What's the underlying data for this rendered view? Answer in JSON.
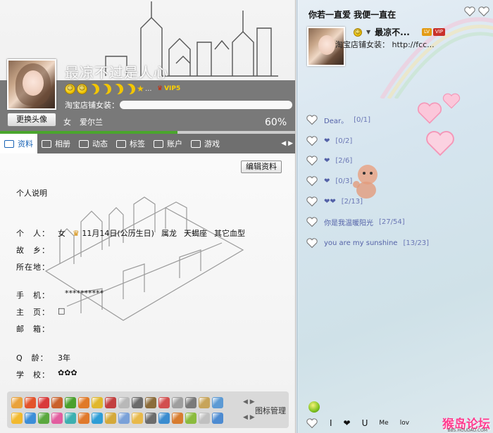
{
  "profile": {
    "nickname": "最凉不过是人心",
    "change_avatar_label": "更换头像",
    "shop_prefix": "淘宝店铺女装：",
    "gender": "女",
    "name": "爱尔兰",
    "completion_percent": "60%",
    "completion_fraction": 0.6,
    "vip_label": "VIP5",
    "level_icons": [
      "smiley-icon",
      "smiley-icon",
      "moon-icon",
      "moon-icon",
      "moon-icon",
      "moon-icon",
      "star-icon"
    ],
    "more_dots": "..."
  },
  "tabs": [
    {
      "label": "资料",
      "icon": "profile-card-icon",
      "active": true
    },
    {
      "label": "相册",
      "icon": "photo-album-icon",
      "active": false
    },
    {
      "label": "动态",
      "icon": "feed-list-icon",
      "active": false
    },
    {
      "label": "标签",
      "icon": "bookmark-icon",
      "active": false
    },
    {
      "label": "账户",
      "icon": "account-icon",
      "active": false
    },
    {
      "label": "游戏",
      "icon": "gamepad-icon",
      "active": false
    }
  ],
  "content": {
    "edit_label": "编辑资料",
    "section_title": "个人说明",
    "fields": {
      "personal_label": "个　人：",
      "hometown_label": "故　乡：",
      "location_label": "所在地：",
      "phone_label": "手　机：",
      "homepage_label": "主　页：",
      "email_label": "邮　箱：",
      "qage_label": "Q　龄：",
      "school_label": "学　校："
    },
    "personal": {
      "gender": "女",
      "birthday": "11月14日(公历生日)",
      "zodiac": "属龙",
      "constellation": "天蝎座",
      "blood": "其它血型"
    },
    "phone": "**********",
    "homepage": "□",
    "qage": "3年",
    "school": "✿✿✿"
  },
  "icons": {
    "manage_label": "图标管理",
    "row1": [
      "#e9a23b",
      "#e3532b",
      "#d93a3a",
      "#c9612b",
      "#4aa02d",
      "#e07a28",
      "#e0b72b",
      "#c23f3f",
      "#b8b8b8",
      "#6b6b6b",
      "#8b6c3b",
      "#d24f4f",
      "#9e9e9e",
      "#7a7a7a",
      "#c7a45a",
      "#5c9ad4"
    ],
    "row2": [
      "#f2b92e",
      "#3c8ed8",
      "#5aa83e",
      "#e25d9f",
      "#3db0b0",
      "#e0792b",
      "#2e9dd6",
      "#d4a93a",
      "#7aa1d8",
      "#e8b94a",
      "#6c6c6c",
      "#3b8ccf",
      "#d77c2f",
      "#8bbb3e",
      "#c0c0c0",
      "#4d8bd1"
    ]
  },
  "right": {
    "title": "你若一直爱 我便一直在",
    "nickname": "最凉不...",
    "badges": [
      "LV",
      "VIP"
    ],
    "shop": "淘宝店铺女装： http://fcc...",
    "feeds": [
      {
        "text": "Dear。",
        "count": "[0/1]"
      },
      {
        "text": "❤",
        "count": "[0/2]"
      },
      {
        "text": "❤",
        "count": "[2/6]"
      },
      {
        "text": "❤",
        "count": "[0/3]"
      },
      {
        "text": "❤❤",
        "count": "[2/13]"
      },
      {
        "text": "你是我温暖阳光",
        "count": "[27/54]"
      },
      {
        "text": "you are my sunshine",
        "count": "[13/23]"
      }
    ],
    "bottom": [
      "I",
      "❤",
      "U",
      "Me",
      "lov"
    ],
    "watermark": "猴岛论坛",
    "watermark_sub": "BBS.HOUDAO.COM"
  },
  "colors": {
    "tab_bar": "#6f6f6f",
    "progress_fill": "#4aa62c",
    "link_purple": "#5462a8",
    "watermark_pink": "#ff3b8f"
  }
}
